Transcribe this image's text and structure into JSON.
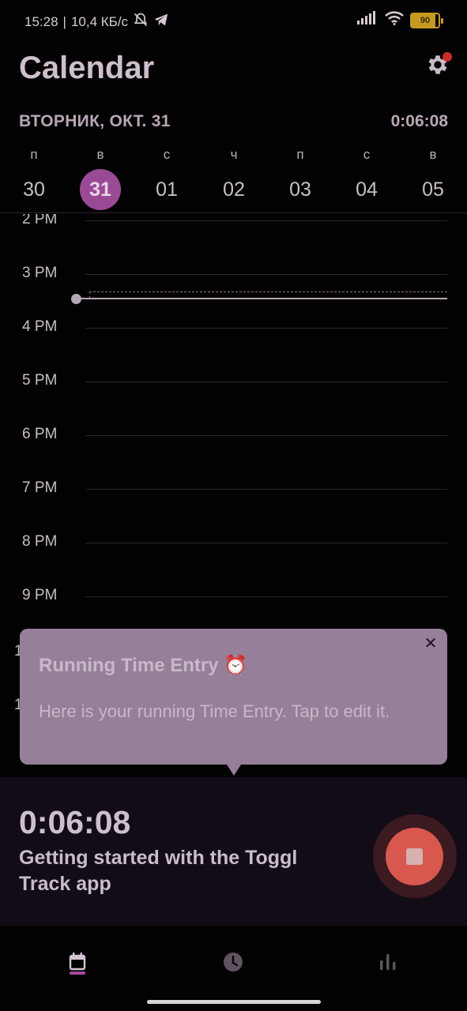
{
  "status_bar": {
    "time": "15:28",
    "separator": "|",
    "network_speed": "10,4 КБ/с",
    "battery_level": "90",
    "icons": [
      "muted-bell-icon",
      "telegram-icon",
      "signal-icon",
      "wifi-icon",
      "battery-icon"
    ]
  },
  "header": {
    "title": "Calendar",
    "settings_icon": "gear-icon",
    "settings_badge_color": "#d12a2a"
  },
  "date_bar": {
    "selected_date_label": "ВТОРНИК, ОКТ. 31",
    "elapsed": "0:06:08"
  },
  "week": {
    "days": [
      {
        "dow": "п",
        "num": "30",
        "selected": false
      },
      {
        "dow": "в",
        "num": "31",
        "selected": true
      },
      {
        "dow": "с",
        "num": "01",
        "selected": false
      },
      {
        "dow": "ч",
        "num": "02",
        "selected": false
      },
      {
        "dow": "п",
        "num": "03",
        "selected": false
      },
      {
        "dow": "с",
        "num": "04",
        "selected": false
      },
      {
        "dow": "в",
        "num": "05",
        "selected": false
      }
    ],
    "accent_color": "#9a4a95"
  },
  "timeline": {
    "hours": [
      "2 PM",
      "3 PM",
      "4 PM",
      "5 PM",
      "6 PM",
      "7 PM",
      "8 PM",
      "9 PM"
    ],
    "peek_labels": [
      "1",
      "1"
    ]
  },
  "tooltip": {
    "title": "Running Time Entry ⏰",
    "body": "Here is your running Time Entry. Tap to edit it.",
    "close_glyph": "✕"
  },
  "running_entry": {
    "duration": "0:06:08",
    "description": "Getting started with the Toggl Track app",
    "stop_color": "#d8584e"
  },
  "bottom_nav": {
    "items": [
      "calendar-icon",
      "clock-icon",
      "bar-chart-icon"
    ],
    "active": "calendar-icon"
  }
}
